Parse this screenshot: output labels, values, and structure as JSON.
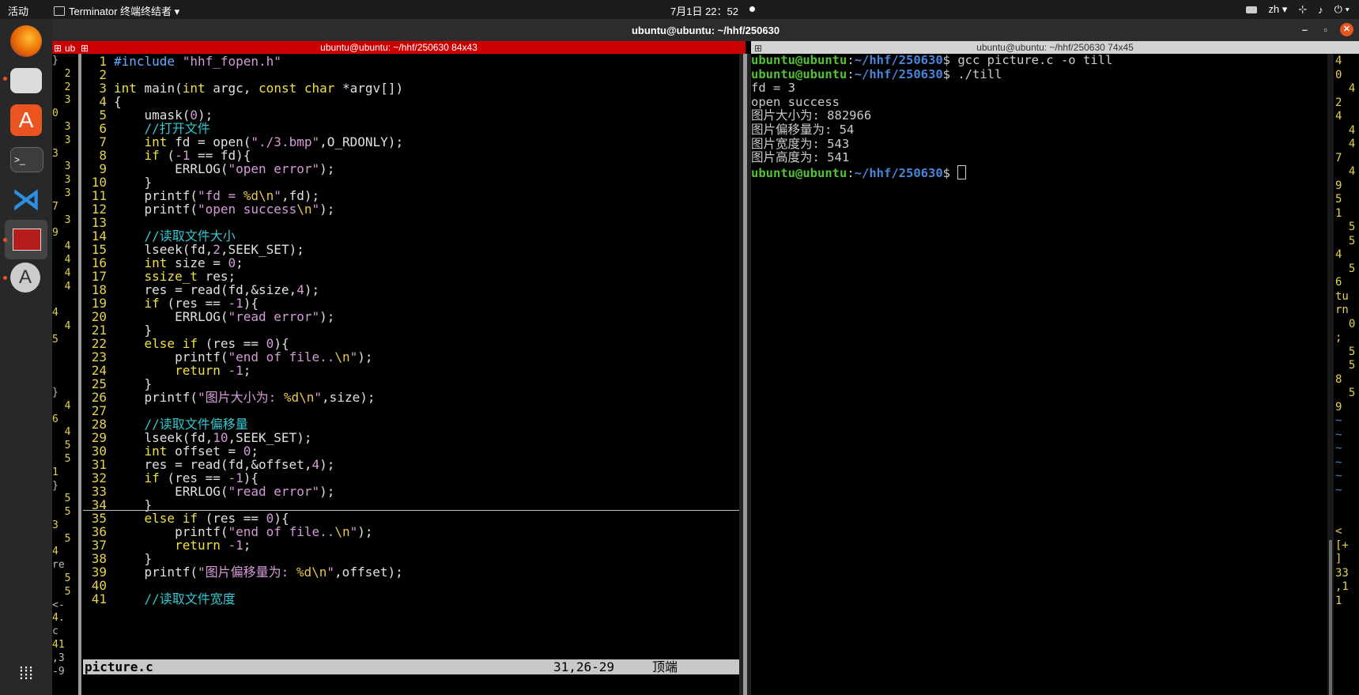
{
  "topbar": {
    "activities": "活动",
    "app_name": "Terminator 终端终结者",
    "clock": "7月1日  22：52",
    "lang": "zh"
  },
  "window": {
    "title": "ubuntu@ubuntu: ~/hhf/250630",
    "minimize": "–",
    "maximize": "▫",
    "close": "✕"
  },
  "left_pane": {
    "header": "ubuntu@ubuntu: ~/hhf/250630 84x43",
    "tab_stub": "ub"
  },
  "right_pane": {
    "header": "ubuntu@ubuntu: ~/hhf/250630 74x45"
  },
  "left_column": [
    "}",
    "  2",
    "  2",
    "  3",
    "0",
    "  3",
    "  3",
    "3",
    "  3",
    "  3",
    "  3",
    "7",
    "  3",
    "9",
    "  4",
    "  4",
    "  4",
    "  4",
    "",
    "4",
    "  4",
    "5",
    "",
    "",
    "",
    "}",
    "  4",
    "6",
    "  4",
    "  5",
    "  5",
    "1",
    "}",
    "  5",
    "  5",
    "3",
    "  5",
    "4",
    "re",
    "  5",
    "  5",
    "<-",
    "4.",
    "c",
    "41",
    ",3",
    "-9"
  ],
  "editor": {
    "lines": [
      {
        "n": "1",
        "text": "#include \"hhf_fopen.h\""
      },
      {
        "n": "2",
        "text": ""
      },
      {
        "n": "3",
        "text": "int main(int argc, const char *argv[])"
      },
      {
        "n": "4",
        "text": "{"
      },
      {
        "n": "5",
        "text": "    umask(0);"
      },
      {
        "n": "6",
        "text": "    //打开文件"
      },
      {
        "n": "7",
        "text": "    int fd = open(\"./3.bmp\",O_RDONLY);"
      },
      {
        "n": "8",
        "text": "    if (-1 == fd){"
      },
      {
        "n": "9",
        "text": "        ERRLOG(\"open error\");"
      },
      {
        "n": "10",
        "text": "    }"
      },
      {
        "n": "11",
        "text": "    printf(\"fd = %d\\n\",fd);"
      },
      {
        "n": "12",
        "text": "    printf(\"open success\\n\");"
      },
      {
        "n": "13",
        "text": ""
      },
      {
        "n": "14",
        "text": "    //读取文件大小"
      },
      {
        "n": "15",
        "text": "    lseek(fd,2,SEEK_SET);"
      },
      {
        "n": "16",
        "text": "    int size = 0;"
      },
      {
        "n": "17",
        "text": "    ssize_t res;"
      },
      {
        "n": "18",
        "text": "    res = read(fd,&size,4);"
      },
      {
        "n": "19",
        "text": "    if (res == -1){"
      },
      {
        "n": "20",
        "text": "        ERRLOG(\"read error\");"
      },
      {
        "n": "21",
        "text": "    }"
      },
      {
        "n": "22",
        "text": "    else if (res == 0){"
      },
      {
        "n": "23",
        "text": "        printf(\"end of file..\\n\");"
      },
      {
        "n": "24",
        "text": "        return -1;"
      },
      {
        "n": "25",
        "text": "    }"
      },
      {
        "n": "26",
        "text": "    printf(\"图片大小为: %d\\n\",size);"
      },
      {
        "n": "27",
        "text": ""
      },
      {
        "n": "28",
        "text": "    //读取文件偏移量"
      },
      {
        "n": "29",
        "text": "    lseek(fd,10,SEEK_SET);"
      },
      {
        "n": "30",
        "text": "    int offset = 0;"
      },
      {
        "n": "31",
        "text": "    res = read(fd,&offset,4);"
      },
      {
        "n": "32",
        "text": "    if (res == -1){"
      },
      {
        "n": "33",
        "text": "        ERRLOG(\"read error\");"
      },
      {
        "n": "34",
        "text": "    }"
      },
      {
        "n": "35",
        "text": "    else if (res == 0){"
      },
      {
        "n": "36",
        "text": "        printf(\"end of file..\\n\");"
      },
      {
        "n": "37",
        "text": "        return -1;"
      },
      {
        "n": "38",
        "text": "    }"
      },
      {
        "n": "39",
        "text": "    printf(\"图片偏移量为: %d\\n\",offset);"
      },
      {
        "n": "40",
        "text": ""
      },
      {
        "n": "41",
        "text": "    //读取文件宽度"
      }
    ],
    "status_file": "picture.c",
    "status_pos": "31,26-29",
    "status_scroll": "顶端"
  },
  "terminal": {
    "prompt_user": "ubuntu@ubuntu",
    "prompt_dir": "~/hhf/250630",
    "cmd1": "gcc picture.c -o till",
    "cmd2": "./till",
    "out": [
      "fd = 3",
      "open success",
      "图片大小为: 882966",
      "图片偏移量为: 54",
      "图片宽度为: 543",
      "图片高度为: 541"
    ]
  },
  "right_column": [
    "4",
    "0",
    "  4",
    "2",
    "4",
    "  4",
    "  4",
    "7",
    "  4",
    "9",
    "5",
    "1",
    "  5",
    "  5",
    "4",
    "  5",
    "6",
    "tu",
    "rn",
    "  0",
    ";",
    "  5",
    "  5",
    "8",
    "  5",
    "9",
    "~",
    "~",
    "~",
    "~",
    "~",
    "~",
    "",
    "",
    "<",
    "[+",
    "]",
    "33",
    ",1",
    "1"
  ],
  "colors": {
    "accent": "#e95420",
    "left_header": "#cc0000",
    "prompt_user": "#52c234",
    "prompt_dir": "#4a84d8"
  }
}
